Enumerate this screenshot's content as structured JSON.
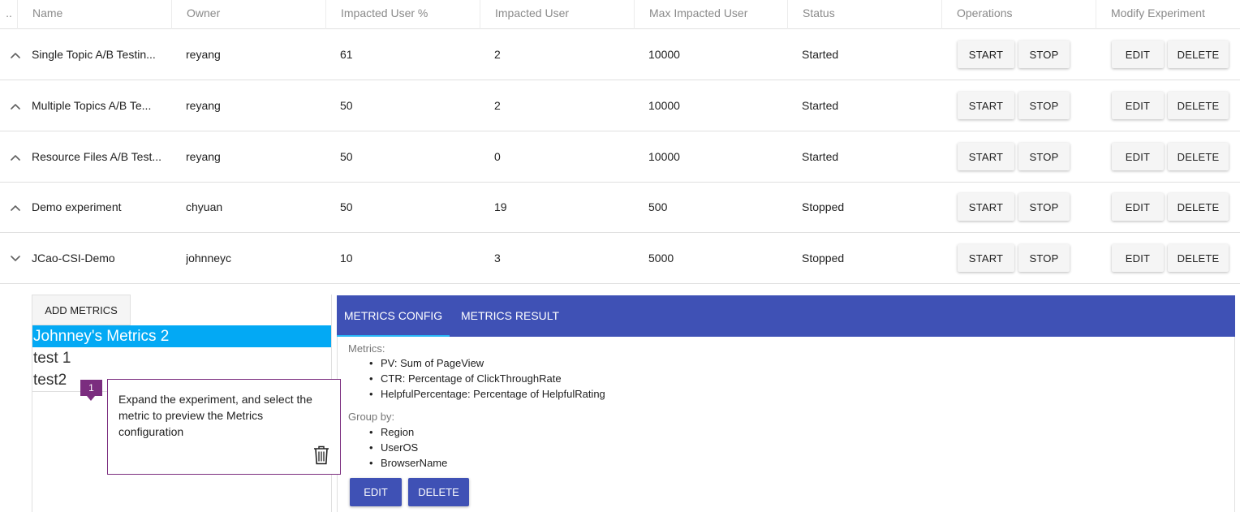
{
  "table": {
    "headers": {
      "dots": "..",
      "name": "Name",
      "owner": "Owner",
      "impacted_pct": "Impacted User %",
      "impacted": "Impacted User",
      "max_impacted": "Max Impacted User",
      "status": "Status",
      "operations": "Operations",
      "modify": "Modify Experiment"
    },
    "rows": [
      {
        "expanded": false,
        "name": "Single Topic A/B Testin...",
        "owner": "reyang",
        "impacted_pct": "61",
        "impacted": "2",
        "max_impacted": "10000",
        "status": "Started",
        "start": "START",
        "stop": "STOP",
        "edit": "EDIT",
        "delete": "DELETE"
      },
      {
        "expanded": false,
        "name": "Multiple Topics A/B Te...",
        "owner": "reyang",
        "impacted_pct": "50",
        "impacted": "2",
        "max_impacted": "10000",
        "status": "Started",
        "start": "START",
        "stop": "STOP",
        "edit": "EDIT",
        "delete": "DELETE"
      },
      {
        "expanded": false,
        "name": "Resource Files A/B Test...",
        "owner": "reyang",
        "impacted_pct": "50",
        "impacted": "0",
        "max_impacted": "10000",
        "status": "Started",
        "start": "START",
        "stop": "STOP",
        "edit": "EDIT",
        "delete": "DELETE"
      },
      {
        "expanded": false,
        "name": "Demo experiment",
        "owner": "chyuan",
        "impacted_pct": "50",
        "impacted": "19",
        "max_impacted": "500",
        "status": "Stopped",
        "start": "START",
        "stop": "STOP",
        "edit": "EDIT",
        "delete": "DELETE"
      },
      {
        "expanded": true,
        "name": "JCao-CSI-Demo",
        "owner": "johnneyc",
        "impacted_pct": "10",
        "impacted": "3",
        "max_impacted": "5000",
        "status": "Stopped",
        "start": "START",
        "stop": "STOP",
        "edit": "EDIT",
        "delete": "DELETE"
      }
    ]
  },
  "metrics_panel": {
    "add_metrics_label": "ADD METRICS",
    "items": [
      {
        "label": "Johnney's Metrics 2",
        "selected": true
      },
      {
        "label": "test 1",
        "selected": false
      },
      {
        "label": "test2",
        "selected": false
      }
    ]
  },
  "config_panel": {
    "tabs": [
      {
        "label": "METRICS CONFIG",
        "active": true
      },
      {
        "label": "METRICS RESULT",
        "active": false
      }
    ],
    "metrics_label": "Metrics:",
    "metrics": [
      "PV: Sum of PageView",
      "CTR: Percentage of ClickThroughRate",
      "HelpfulPercentage: Percentage of HelpfulRating"
    ],
    "group_by_label": "Group by:",
    "group_by": [
      "Region",
      "UserOS",
      "BrowserName"
    ],
    "edit_label": "EDIT",
    "delete_label": "DELETE"
  },
  "annotation": {
    "badge": "1",
    "text": "Expand the experiment, and select the metric to preview the Metrics configuration",
    "icon": "trash-icon"
  },
  "colors": {
    "accent": "#3f51b5",
    "selected": "#03a9f4",
    "annotation": "#7b2d7f"
  }
}
